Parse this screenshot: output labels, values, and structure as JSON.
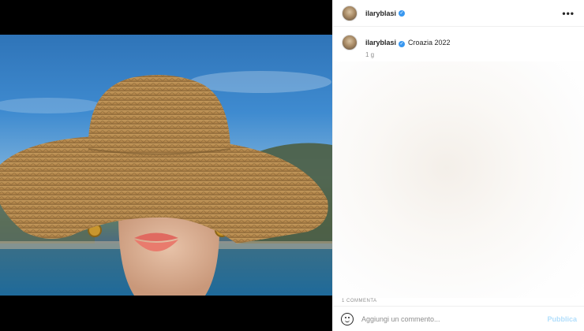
{
  "post": {
    "username": "ilaryblasi",
    "verified_glyph": "✓",
    "more_glyph": "•••",
    "icons": [
      "more-options-icon",
      "verified-badge-icon",
      "emoji-icon"
    ]
  },
  "caption": {
    "username": "ilaryblasi",
    "text": "Croazia 2022",
    "time": "1 g"
  },
  "likes_text": "1 COMMENTA",
  "comment_bar": {
    "placeholder": "Aggiungi un commento...",
    "publish_label": "Pubblica"
  },
  "colors": {
    "accent": "#3897f0",
    "publish_disabled": "#b2dffc"
  }
}
